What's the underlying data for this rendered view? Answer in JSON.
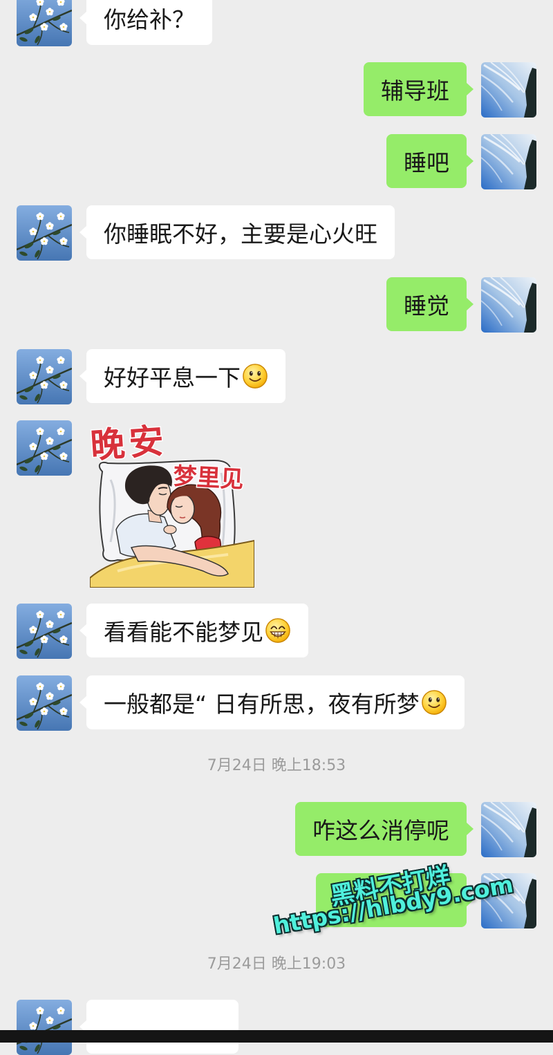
{
  "chat": {
    "messages": [
      {
        "side": "left",
        "type": "text",
        "text": "你给补？"
      },
      {
        "side": "right",
        "type": "text",
        "text": "辅导班"
      },
      {
        "side": "right",
        "type": "text",
        "text": "睡吧"
      },
      {
        "side": "left",
        "type": "text",
        "text": "你睡眠不好，主要是心火旺"
      },
      {
        "side": "right",
        "type": "text",
        "text": "睡觉"
      },
      {
        "side": "left",
        "type": "text",
        "text": "好好平息一下",
        "emoji": "smile-icon"
      },
      {
        "side": "left",
        "type": "sticker",
        "sticker": {
          "title": "晚安",
          "subtitle": "梦里见",
          "icon": "sleeping-couple-sticker"
        }
      },
      {
        "side": "left",
        "type": "text",
        "text": "看看能不能梦见",
        "emoji": "grin-icon"
      },
      {
        "side": "left",
        "type": "text",
        "text": "一般都是“ 日有所思，夜有所梦",
        "emoji": "smile-icon"
      },
      {
        "type": "timestamp",
        "text": "7月24日 晚上18:53"
      },
      {
        "side": "right",
        "type": "text",
        "text": "咋这么消停呢"
      },
      {
        "side": "right",
        "type": "text"
      },
      {
        "type": "timestamp",
        "text": "7月24日 晚上19:03"
      },
      {
        "side": "left",
        "type": "text"
      }
    ]
  },
  "avatars": {
    "contact": "flower-branch-avatar",
    "self": "sky-clouds-avatar"
  },
  "watermark": {
    "line1": "黑料不打烊",
    "line2": "https://hlbdy9.com"
  },
  "colors": {
    "background": "#ededed",
    "bubble_self": "#95ec69",
    "bubble_contact": "#ffffff",
    "text": "#191919",
    "timestamp": "#9b9b9b",
    "watermark": "#4ff0dc",
    "sticker_text": "#d8313b"
  }
}
